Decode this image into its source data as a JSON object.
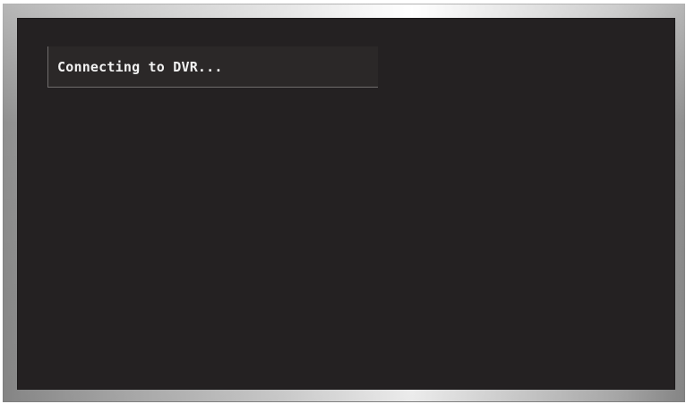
{
  "dvr_status": {
    "message": "Connecting to DVR..."
  },
  "colors": {
    "screen_background": "#242122",
    "status_background": "#2b2828",
    "status_text": "#f2f2f2",
    "frame_highlight": "#ffffff",
    "frame_shadow": "#8f8f8f"
  }
}
